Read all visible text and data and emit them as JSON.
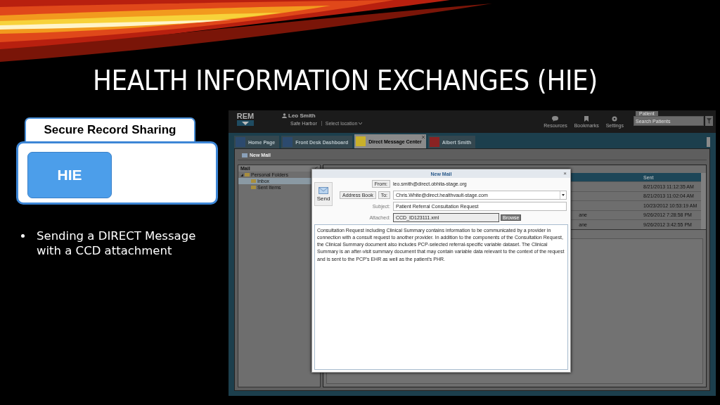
{
  "slide": {
    "title": "HEALTH INFORMATION EXCHANGES (HIE)",
    "category_tab": "Secure Record Sharing",
    "category_button": "HIE",
    "bullets": [
      "Sending a DIRECT Message with a CCD attachment"
    ]
  },
  "app": {
    "logo": "REM",
    "user": {
      "name": "Leo Smith",
      "organization": "Safe Harbor",
      "location": "Select location"
    },
    "toolbar_buttons": [
      {
        "label": "Resources",
        "kind": "chat"
      },
      {
        "label": "Bookmarks",
        "kind": "bookmark"
      },
      {
        "label": "Settings",
        "kind": "gear"
      }
    ],
    "patient_tab": "Patient",
    "patient_search": {
      "placeholder": "Search Patients"
    },
    "tabs": [
      {
        "label": "Home Page",
        "selected": false,
        "closable": false,
        "color": "#2c4a6e"
      },
      {
        "label": "Front Desk Dashboard",
        "selected": false,
        "closable": false,
        "color": "#2c4a6e"
      },
      {
        "label": "Direct Message Center",
        "selected": true,
        "closable": true,
        "color": "#c9b02a"
      },
      {
        "label": "Albert Smith",
        "selected": false,
        "closable": false,
        "color": "#8a2323"
      }
    ],
    "action": "New Mail",
    "mail_pane": {
      "title": "Mail",
      "folders": [
        {
          "label": "Personal Folders",
          "expanded": true,
          "selected": false,
          "children": [
            {
              "label": "Inbox",
              "selected": true
            },
            {
              "label": "Sent Items",
              "selected": false
            }
          ]
        }
      ]
    },
    "message_table": {
      "columns": [
        "Sent"
      ],
      "rows": [
        {
          "sent": "8/21/2013 11:12:35 AM"
        },
        {
          "sent": "8/21/2013 11:02:04 AM"
        },
        {
          "sent": "10/23/2012 10:53:19 AM"
        },
        {
          "column_1": "ane",
          "sent": "9/26/2012 7:28:58 PM"
        },
        {
          "column_1": "ane",
          "sent": "9/26/2012 3:42:55 PM"
        }
      ]
    },
    "compose": {
      "title": "New Mail",
      "close": "×",
      "send": "Send",
      "from_button": "From:",
      "from": "leo.smith@direct.obhita-stage.org",
      "address_book": "Address Book",
      "to_button": "To:",
      "to": "Chris.White@direct.healthvault-stage.com",
      "subject_label": "Subject:",
      "subject": "Patient Referral Consultation Request",
      "attached_label": "Attached:",
      "attached": "CCD_ID123111.xml",
      "browse": "Browse",
      "body": "Consultation Request including Clinical Summary contains information to be communicated by a provider in connection with a consult request to another provider. In addition to the components of the Consultation Request, the Clinical Summary document also includes PCP-selected referral-specific variable dataset. The Clinical Summary is an after-visit summary document that may contain variable data relevant to the context of the request and is sent to the PCP's EHR as well as the patient's PHR."
    }
  }
}
